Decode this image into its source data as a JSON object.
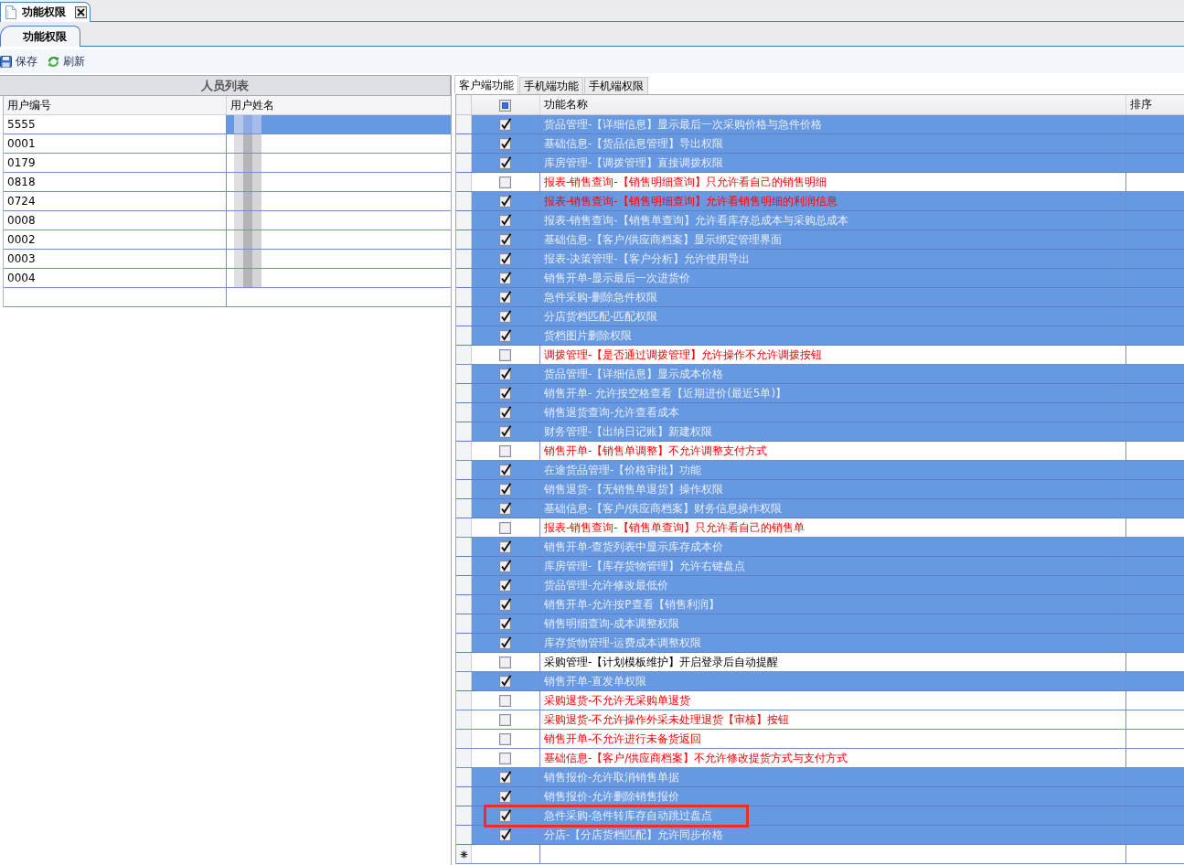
{
  "document_tabs": [
    {
      "label": "功能权限",
      "selected": true,
      "closable": true
    }
  ],
  "sub_tabs": [
    {
      "label": "功能权限",
      "selected": true
    }
  ],
  "toolbar": [
    {
      "kind": "save",
      "label": "保存"
    },
    {
      "kind": "refresh",
      "label": "刷新"
    }
  ],
  "user_list": {
    "title": "人员列表",
    "columns": [
      "用户编号",
      "用户姓名"
    ],
    "rows": [
      {
        "id": "5555",
        "name_redacted": true,
        "selected": true
      },
      {
        "id": "0001",
        "name_redacted": true,
        "selected": false
      },
      {
        "id": "0179",
        "name_redacted": true,
        "selected": false
      },
      {
        "id": "0818",
        "name_redacted": true,
        "selected": false
      },
      {
        "id": "0724",
        "name_redacted": true,
        "selected": false
      },
      {
        "id": "0008",
        "name_redacted": true,
        "selected": false
      },
      {
        "id": "0002",
        "name_redacted": true,
        "selected": false
      },
      {
        "id": "0003",
        "name_redacted": true,
        "selected": false
      },
      {
        "id": "0004",
        "name_redacted": true,
        "selected": false
      }
    ],
    "new_row": true
  },
  "permission_tabs": [
    {
      "label": "客户端功能",
      "selected": true
    },
    {
      "label": "手机端功能",
      "selected": false
    },
    {
      "label": "手机端权限",
      "selected": false
    }
  ],
  "permission_grid": {
    "select_all_indeterminate": true,
    "columns": [
      "功能名称",
      "排序"
    ],
    "rows": [
      {
        "name": "货品管理-【详细信息】显示最后一次采购价格与急件价格",
        "checked": true,
        "important": false,
        "highlighted": false
      },
      {
        "name": "基础信息-【货品信息管理】导出权限",
        "checked": true,
        "important": false,
        "highlighted": false
      },
      {
        "name": "库房管理-【调拨管理】直接调拨权限",
        "checked": true,
        "important": false,
        "highlighted": false
      },
      {
        "name": "报表-销售查询-【销售明细查询】只允许看自己的销售明细",
        "checked": false,
        "important": true,
        "highlighted": false
      },
      {
        "name": "报表-销售查询-【销售明细查询】允许看销售明细的利润信息",
        "checked": true,
        "important": true,
        "highlighted": false
      },
      {
        "name": "报表-销售查询-【销售单查询】允许看库存总成本与采购总成本",
        "checked": true,
        "important": false,
        "highlighted": false
      },
      {
        "name": "基础信息-【客户/供应商档案】显示绑定管理界面",
        "checked": true,
        "important": false,
        "highlighted": false
      },
      {
        "name": "报表-决策管理-【客户分析】允许使用导出",
        "checked": true,
        "important": false,
        "highlighted": false
      },
      {
        "name": "销售开单-显示最后一次进货价",
        "checked": true,
        "important": false,
        "highlighted": false
      },
      {
        "name": "急件采购-删除急件权限",
        "checked": true,
        "important": false,
        "highlighted": false
      },
      {
        "name": "分店货档匹配-匹配权限",
        "checked": true,
        "important": false,
        "highlighted": false
      },
      {
        "name": "货档图片删除权限",
        "checked": true,
        "important": false,
        "highlighted": false
      },
      {
        "name": "调拨管理-【是否通过调拨管理】允许操作不允许调拨按钮",
        "checked": false,
        "important": true,
        "highlighted": false
      },
      {
        "name": "货品管理-【详细信息】显示成本价格",
        "checked": true,
        "important": false,
        "highlighted": false
      },
      {
        "name": "销售开单- 允许按空格查看【近期进价(最近5单)】",
        "checked": true,
        "important": false,
        "highlighted": false
      },
      {
        "name": "销售退货查询-允许查看成本",
        "checked": true,
        "important": false,
        "highlighted": false
      },
      {
        "name": "财务管理-【出纳日记账】新建权限",
        "checked": true,
        "important": false,
        "highlighted": false
      },
      {
        "name": "销售开单-【销售单调整】不允许调整支付方式",
        "checked": false,
        "important": true,
        "highlighted": false
      },
      {
        "name": "在途货品管理-【价格审批】功能",
        "checked": true,
        "important": false,
        "highlighted": false
      },
      {
        "name": "销售退货-【无销售单退货】操作权限",
        "checked": true,
        "important": false,
        "highlighted": false
      },
      {
        "name": "基础信息-【客户/供应商档案】财务信息操作权限",
        "checked": true,
        "important": false,
        "highlighted": false
      },
      {
        "name": "报表-销售查询-【销售单查询】只允许看自己的销售单",
        "checked": false,
        "important": true,
        "highlighted": false
      },
      {
        "name": "销售开单-查货列表中显示库存成本价",
        "checked": true,
        "important": false,
        "highlighted": false
      },
      {
        "name": "库房管理-【库存货物管理】允许右键盘点",
        "checked": true,
        "important": false,
        "highlighted": false
      },
      {
        "name": "货品管理-允许修改最低价",
        "checked": true,
        "important": false,
        "highlighted": false
      },
      {
        "name": "销售开单-允许按P查看【销售利润】",
        "checked": true,
        "important": false,
        "highlighted": false
      },
      {
        "name": "销售明细查询-成本调整权限",
        "checked": true,
        "important": false,
        "highlighted": false
      },
      {
        "name": "库存货物管理-运费成本调整权限",
        "checked": true,
        "important": false,
        "highlighted": false
      },
      {
        "name": "采购管理-【计划模板维护】开启登录后自动提醒",
        "checked": false,
        "important": false,
        "highlighted": false
      },
      {
        "name": "销售开单-直发单权限",
        "checked": true,
        "important": false,
        "highlighted": false
      },
      {
        "name": "采购退货-不允许无采购单退货",
        "checked": false,
        "important": true,
        "highlighted": false
      },
      {
        "name": "采购退货-不允许操作外采未处理退货【审核】按钮",
        "checked": false,
        "important": true,
        "highlighted": false
      },
      {
        "name": "销售开单-不允许进行未备货返回",
        "checked": false,
        "important": true,
        "highlighted": false
      },
      {
        "name": "基础信息-【客户/供应商档案】不允许修改提货方式与支付方式",
        "checked": false,
        "important": true,
        "highlighted": false
      },
      {
        "name": "销售报价-允许取消销售单据",
        "checked": true,
        "important": false,
        "highlighted": false
      },
      {
        "name": "销售报价-允许删除销售报价",
        "checked": true,
        "important": false,
        "highlighted": false
      },
      {
        "name": "急件采购-急件转库存自动跳过盘点",
        "checked": true,
        "important": false,
        "highlighted": true
      },
      {
        "name": "分店-【分店货档匹配】允许同步价格",
        "checked": true,
        "important": false,
        "highlighted": false
      }
    ],
    "new_row": true
  }
}
